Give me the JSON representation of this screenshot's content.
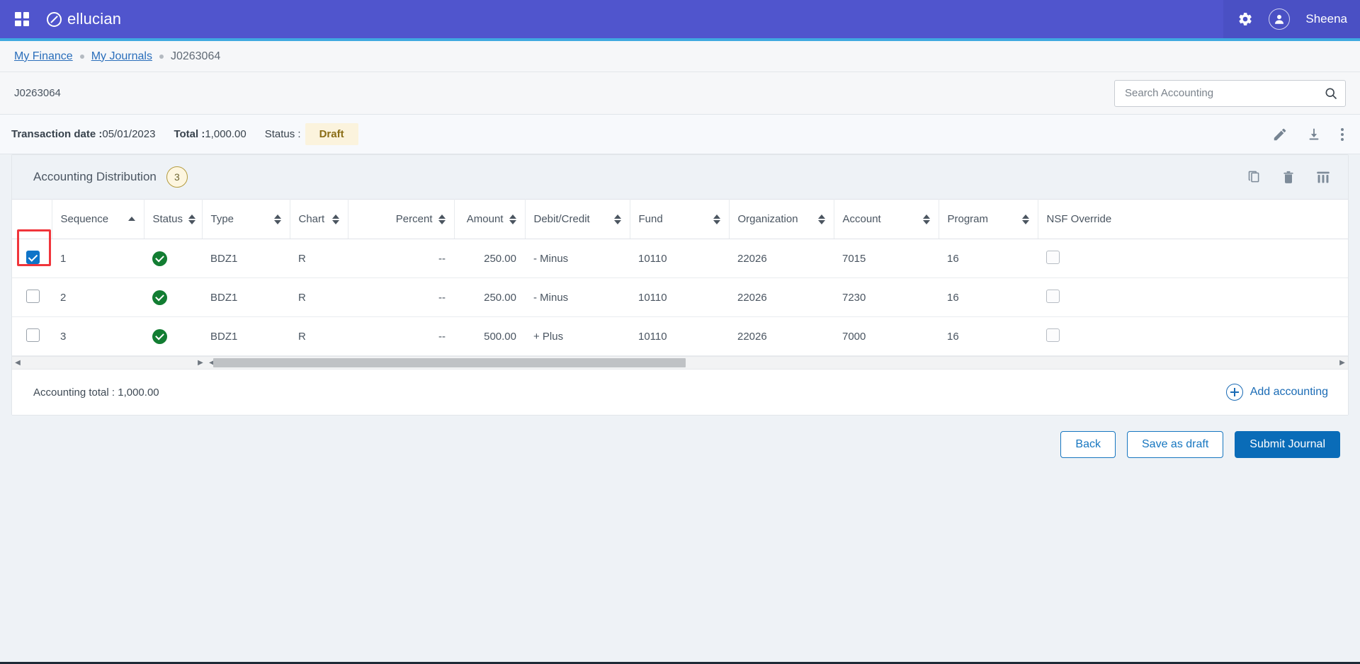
{
  "appbar": {
    "brand": "ellucian",
    "waffle_icon": "grid-apps-icon",
    "settings_icon": "gear-icon",
    "avatar_icon": "user-avatar-icon",
    "username": "Sheena"
  },
  "breadcrumb": {
    "items": [
      {
        "label": "My Finance",
        "type": "link"
      },
      {
        "label": "My Journals",
        "type": "link"
      },
      {
        "label": "J0263064",
        "type": "current"
      }
    ]
  },
  "idbar": {
    "journal_id": "J0263064",
    "search": {
      "placeholder": "Search Accounting",
      "value": "",
      "icon": "search-icon"
    }
  },
  "meta": {
    "transaction_date_label": "Transaction date :",
    "transaction_date_value": "05/01/2023",
    "total_label": "Total :",
    "total_value": "1,000.00",
    "status_label": "Status :",
    "status_value": "Draft",
    "actions": [
      {
        "name": "edit-icon",
        "title": "Edit"
      },
      {
        "name": "download-icon",
        "title": "Download"
      },
      {
        "name": "more-options-icon",
        "title": "More"
      }
    ]
  },
  "section": {
    "title": "Accounting Distribution",
    "count": "3",
    "actions": [
      {
        "name": "copy-icon",
        "title": "Copy"
      },
      {
        "name": "delete-icon",
        "title": "Delete"
      },
      {
        "name": "column-settings-icon",
        "title": "Columns"
      }
    ]
  },
  "table": {
    "columns": [
      {
        "key": "select",
        "label": "",
        "sortable": false,
        "align": "left"
      },
      {
        "key": "sequence",
        "label": "Sequence",
        "sortable": true,
        "sorted": "asc",
        "align": "left"
      },
      {
        "key": "status",
        "label": "Status",
        "sortable": true,
        "align": "left"
      },
      {
        "key": "type",
        "label": "Type",
        "sortable": true,
        "align": "left"
      },
      {
        "key": "chart",
        "label": "Chart",
        "sortable": true,
        "align": "left"
      },
      {
        "key": "percent",
        "label": "Percent",
        "sortable": true,
        "align": "right"
      },
      {
        "key": "amount",
        "label": "Amount",
        "sortable": true,
        "align": "right"
      },
      {
        "key": "debit_credit",
        "label": "Debit/Credit",
        "sortable": true,
        "align": "left"
      },
      {
        "key": "fund",
        "label": "Fund",
        "sortable": true,
        "align": "left"
      },
      {
        "key": "organization",
        "label": "Organization",
        "sortable": true,
        "align": "left"
      },
      {
        "key": "account",
        "label": "Account",
        "sortable": true,
        "align": "left"
      },
      {
        "key": "program",
        "label": "Program",
        "sortable": true,
        "align": "left"
      },
      {
        "key": "nsf_override",
        "label": "NSF Override",
        "sortable": false,
        "align": "left"
      }
    ],
    "rows": [
      {
        "selected": true,
        "highlighted": true,
        "sequence": "1",
        "status": "valid",
        "type": "BDZ1",
        "chart": "R",
        "percent": "--",
        "amount": "250.00",
        "debit_credit": "- Minus",
        "fund": "10110",
        "organization": "22026",
        "account": "7015",
        "program": "16",
        "nsf_override": false
      },
      {
        "selected": false,
        "highlighted": false,
        "sequence": "2",
        "status": "valid",
        "type": "BDZ1",
        "chart": "R",
        "percent": "--",
        "amount": "250.00",
        "debit_credit": "- Minus",
        "fund": "10110",
        "organization": "22026",
        "account": "7230",
        "program": "16",
        "nsf_override": false
      },
      {
        "selected": false,
        "highlighted": false,
        "sequence": "3",
        "status": "valid",
        "type": "BDZ1",
        "chart": "R",
        "percent": "--",
        "amount": "500.00",
        "debit_credit": "+ Plus",
        "fund": "10110",
        "organization": "22026",
        "account": "7000",
        "program": "16",
        "nsf_override": false
      }
    ]
  },
  "card_footer": {
    "total_text": "Accounting total : 1,000.00",
    "add_label": "Add accounting",
    "add_icon": "plus-circle-icon"
  },
  "buttons": {
    "back": "Back",
    "save_draft": "Save as draft",
    "submit": "Submit Journal"
  },
  "colors": {
    "appbar": "#5055cd",
    "accent_rule": "#3fa9e0",
    "primary": "#0a6cb8",
    "link": "#1676c0",
    "status_chip_bg": "#fbf3dd",
    "status_chip_text": "#8a6d16",
    "valid_green": "#127d32",
    "checkbox_blue": "#0f74c8",
    "highlight_red": "#f0353b"
  }
}
